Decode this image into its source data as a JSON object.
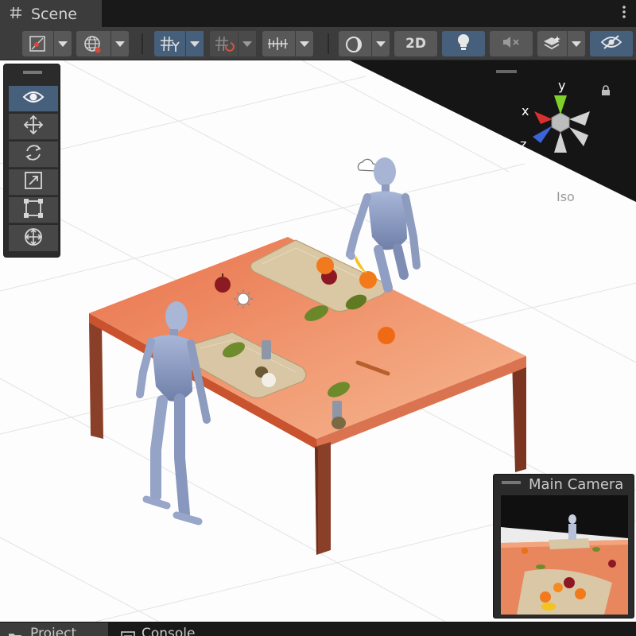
{
  "window": {
    "tab_title": "Scene",
    "tab_icon": "hash-grid-icon",
    "menu_icon": "kebab-menu-icon"
  },
  "toolbar": {
    "buttons": [
      {
        "name": "draw-mode-button",
        "icon": "shaded-draw-icon",
        "dropdown": true
      },
      {
        "name": "global-local-button",
        "icon": "globe-icon",
        "dropdown": true
      },
      {
        "name": "grid-snap-button",
        "icon": "grid-y-icon",
        "dropdown": true,
        "active": true
      },
      {
        "name": "snap-increment-button",
        "icon": "snap-grid-icon",
        "dropdown": true
      },
      {
        "name": "ruler-button",
        "icon": "ruler-icon",
        "dropdown": true
      },
      {
        "name": "shading-button",
        "icon": "sphere-icon",
        "dropdown": true
      },
      {
        "name": "toggle-2d-button",
        "label": "2D"
      },
      {
        "name": "lighting-button",
        "icon": "lightbulb-icon",
        "active": true
      },
      {
        "name": "audio-button",
        "icon": "mute-icon"
      },
      {
        "name": "effects-button",
        "icon": "layers-icon",
        "dropdown": true
      },
      {
        "name": "visibility-button",
        "icon": "hidden-eye-icon",
        "active": true
      }
    ],
    "label_2d": "2D"
  },
  "tools": [
    {
      "name": "view-tool",
      "icon": "eye-icon",
      "active": true
    },
    {
      "name": "move-tool",
      "icon": "move-arrows-icon"
    },
    {
      "name": "rotate-tool",
      "icon": "rotate-icon"
    },
    {
      "name": "scale-tool",
      "icon": "scale-icon"
    },
    {
      "name": "rect-tool",
      "icon": "rect-transform-icon"
    },
    {
      "name": "transform-tool",
      "icon": "transform-icon"
    }
  ],
  "gizmo": {
    "x_label": "x",
    "y_label": "y",
    "z_label": "z",
    "projection": "Iso",
    "colors": {
      "x": "#d6312e",
      "y": "#7fd12a",
      "z": "#3b64d9"
    },
    "lock_icon": "lock-icon"
  },
  "camera_preview": {
    "title": "Main Camera"
  },
  "bottom_tabs": [
    {
      "name": "project-tab",
      "label": "Project",
      "icon": "folder-icon"
    },
    {
      "name": "console-tab",
      "label": "Console",
      "icon": "console-icon"
    }
  ],
  "colors": {
    "accent": "#46607c",
    "panel": "#3c3c3c",
    "table_top": "#ef8d66",
    "table_legs": "#8a3f28",
    "board": "#ddc9a6"
  }
}
